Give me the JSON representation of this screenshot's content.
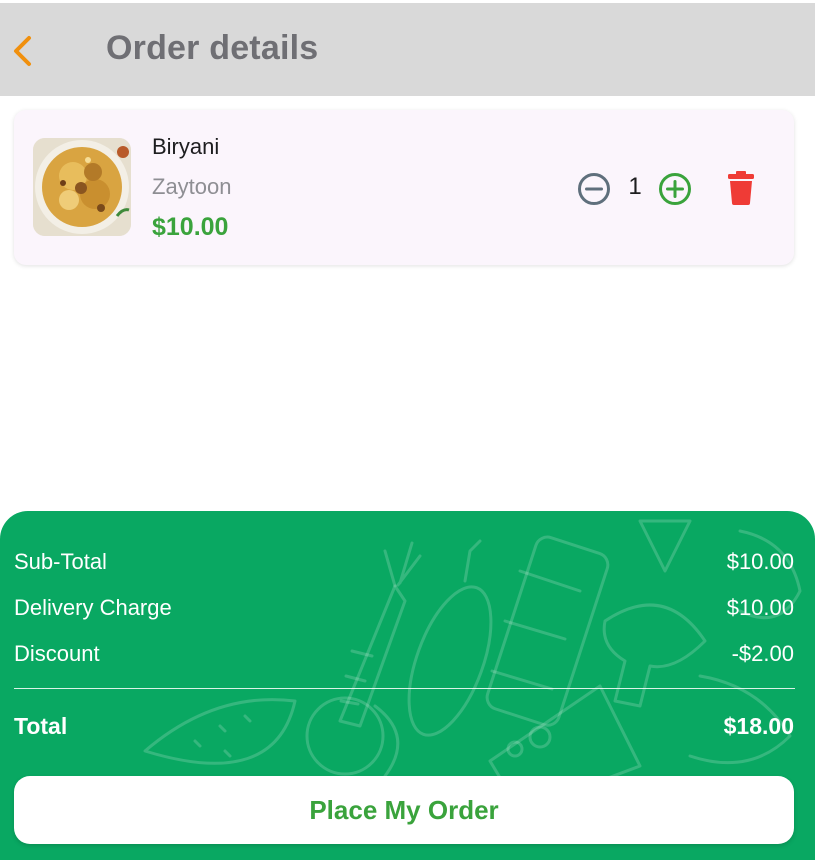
{
  "header": {
    "title": "Order details",
    "back_icon": "chevron-left-icon",
    "back_color": "#f0900e"
  },
  "cart": {
    "items": [
      {
        "name": "Biryani",
        "restaurant": "Zaytoon",
        "price": "$10.00",
        "quantity": "1",
        "image_icon": "biryani-dish-image",
        "minus_icon": "minus-circle-icon",
        "plus_icon": "plus-circle-icon",
        "delete_icon": "trash-icon"
      }
    ]
  },
  "summary": {
    "subtotal_label": "Sub-Total",
    "subtotal_value": "$10.00",
    "delivery_label": "Delivery Charge",
    "delivery_value": "$10.00",
    "discount_label": "Discount",
    "discount_value": "-$2.00",
    "total_label": "Total",
    "total_value": "$18.00"
  },
  "actions": {
    "place_order_label": "Place My Order"
  },
  "colors": {
    "panel_green": "#09a862",
    "price_green": "#3aa33c",
    "delete_red": "#ef3b36",
    "header_gray": "#d9d9d9"
  }
}
